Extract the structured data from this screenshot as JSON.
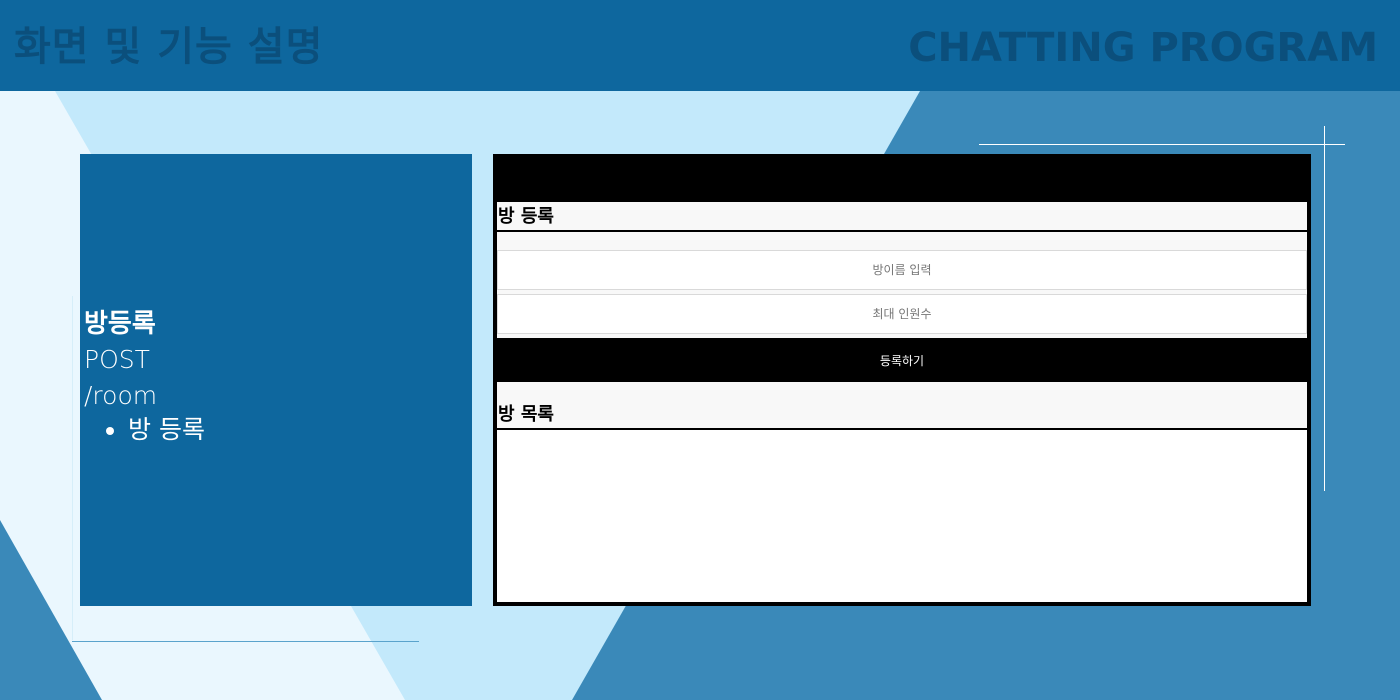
{
  "slide": {
    "title": "화면 및 기능 설명",
    "brand": "CHATTING PROGRAM"
  },
  "info": {
    "title": "방등록",
    "method": "POST",
    "path": "/room",
    "bullets": [
      "방 등록"
    ]
  },
  "mock": {
    "register_header": "방 등록",
    "room_name_placeholder": "방이름 입력",
    "max_users_placeholder": "최대 인원수",
    "submit_label": "등록하기",
    "list_header": "방 목록"
  },
  "colors": {
    "header_bg": "#0e679e",
    "header_text": "#0b4f7c",
    "light_bg": "#c3e9fb",
    "mid_blue": "#3a89b9",
    "panel_bg": "#0e679e"
  }
}
